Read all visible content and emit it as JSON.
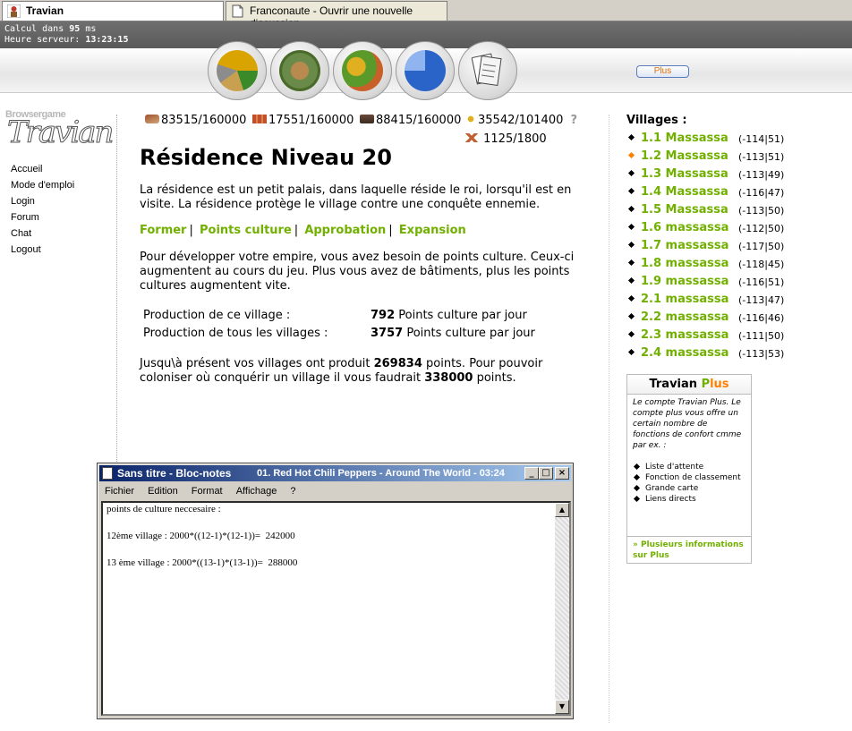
{
  "tabs": [
    {
      "label": "Travian"
    },
    {
      "label": "Franconaute - Ouvrir une nouvelle discussion"
    }
  ],
  "topbar": {
    "calc_prefix": "Calcul dans ",
    "calc_value": "95",
    "calc_suffix": " ms",
    "server_prefix": "Heure serveur: ",
    "server_time": "13:23:15"
  },
  "nav": {
    "plus_button": "Plus"
  },
  "logo": {
    "top_text": "Browsergame",
    "main_text": "Travian"
  },
  "left_menu": [
    "Accueil",
    "Mode d'emploi",
    "Login",
    "Forum",
    "Chat",
    "Logout"
  ],
  "resources": {
    "wood": "83515/160000",
    "clay": "17551/160000",
    "iron": "88415/160000",
    "crop": "35542/101400",
    "help": "?",
    "consumption": "1125/1800"
  },
  "main": {
    "title": "Résidence Niveau 20",
    "intro": "La résidence est un petit palais, dans laquelle réside le roi, lorsqu'il est en visite. La résidence protège le village contre une conquête ennemie.",
    "links": [
      "Former",
      "Points culture",
      "Approbation",
      "Expansion"
    ],
    "culture_text": "Pour développer votre empire, vous avez besoin de points culture. Ceux-ci augmentent au cours du jeu. Plus vous avez de bâtiments, plus les points cultures augmentent vite.",
    "production": [
      {
        "label": "Production de ce village :",
        "value": "792",
        "unit": "Points culture par jour"
      },
      {
        "label": "Production de tous les villages :",
        "value": "3757",
        "unit": "Points culture par jour"
      }
    ],
    "summary_1": "Jusqu\\à présent vos villages ont produit ",
    "summary_value_1": "269834",
    "summary_2": " points. Pour pouvoir coloniser où conquérir un village il vous faudrait ",
    "summary_value_2": "338000",
    "summary_3": " points."
  },
  "villages": {
    "title": "Villages :",
    "items": [
      {
        "name": "1.1 Massassa",
        "coords": "(-114|51)",
        "active": false
      },
      {
        "name": "1.2 Massassa",
        "coords": "(-113|51)",
        "active": true
      },
      {
        "name": "1.3 Massassa",
        "coords": "(-113|49)",
        "active": false
      },
      {
        "name": "1.4 Massassa",
        "coords": "(-116|47)",
        "active": false
      },
      {
        "name": "1.5 Massassa",
        "coords": "(-113|50)",
        "active": false
      },
      {
        "name": "1.6 massassa",
        "coords": "(-112|50)",
        "active": false
      },
      {
        "name": "1.7 massassa",
        "coords": "(-117|50)",
        "active": false
      },
      {
        "name": "1.8 massassa",
        "coords": "(-118|45)",
        "active": false
      },
      {
        "name": "1.9 massassa",
        "coords": "(-116|51)",
        "active": false
      },
      {
        "name": "2.1 massassa",
        "coords": "(-113|47)",
        "active": false
      },
      {
        "name": "2.2 massassa",
        "coords": "(-116|46)",
        "active": false
      },
      {
        "name": "2.3 massassa",
        "coords": "(-111|50)",
        "active": false
      },
      {
        "name": "2.4 massassa",
        "coords": "(-113|53)",
        "active": false
      }
    ]
  },
  "plus_box": {
    "title_prefix": "Travian ",
    "title_plus_p": "P",
    "title_plus_rest": "lus",
    "description": "Le compte Travian Plus. Le compte plus vous offre un certain nombre de fonctions de confort cmme par ex. :",
    "features": [
      "Liste d'attente",
      "Fonction de classement",
      "Grande carte",
      "Liens directs"
    ],
    "footer": "» Plusieurs informations sur Plus"
  },
  "notepad": {
    "title": "Sans titre - Bloc-notes",
    "song": "01. Red Hot Chili Peppers - Around The World - 03:24",
    "menu": [
      "Fichier",
      "Edition",
      "Format",
      "Affichage",
      "?"
    ],
    "text": "points de culture neccesaire :\n\n12ème village : 2000*((12-1)*(12-1))=  242000\n\n13 ème village : 2000*((13-1)*(13-1))=  288000",
    "btn_min": "_",
    "btn_max": "□",
    "btn_close": "×",
    "scroll_up": "▲",
    "scroll_down": "▼"
  },
  "colors": {
    "link_green": "#71b000",
    "active_orange": "#ff8000",
    "titlebar_blue": "#0a246a"
  }
}
